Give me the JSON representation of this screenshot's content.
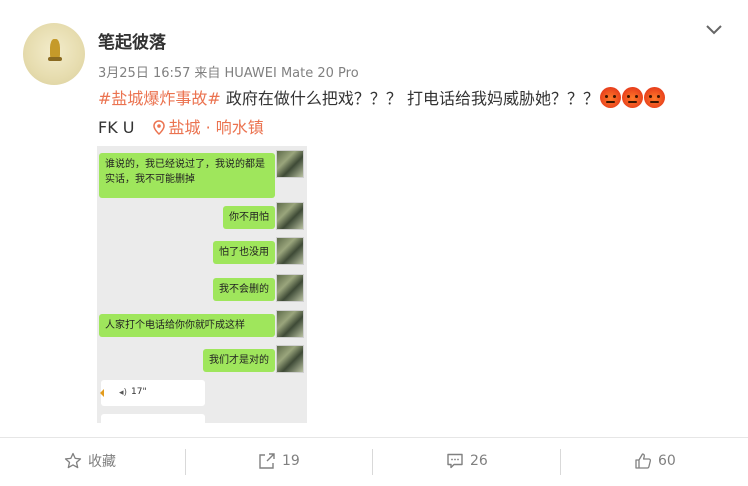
{
  "post": {
    "username": "笔起彼落",
    "date": "3月25日 16:57",
    "source_prefix": "来自",
    "device": "HUAWEI Mate 20 Pro",
    "topic": "#盐城爆炸事故#",
    "text": " 政府在做什么把戏？？？ 打电话给我妈威胁她？？？",
    "line2_text": "FK   U",
    "location": "盐城 · 响水镇",
    "emoji_count": 3
  },
  "screenshot": {
    "messages": [
      "谁说的，我已经说过了，我说的都是实话，我不可能删掉",
      "你不用怕",
      "怕了也没用",
      "我不会删的",
      "人家打个电话给你你就吓成这样",
      "我们才是对的"
    ],
    "voice_duration": "17\""
  },
  "actions": {
    "favorite": "收藏",
    "repost": "19",
    "comment": "26",
    "like": "60"
  },
  "colors": {
    "accent": "#eb7350",
    "bubble": "#9fe65c"
  }
}
